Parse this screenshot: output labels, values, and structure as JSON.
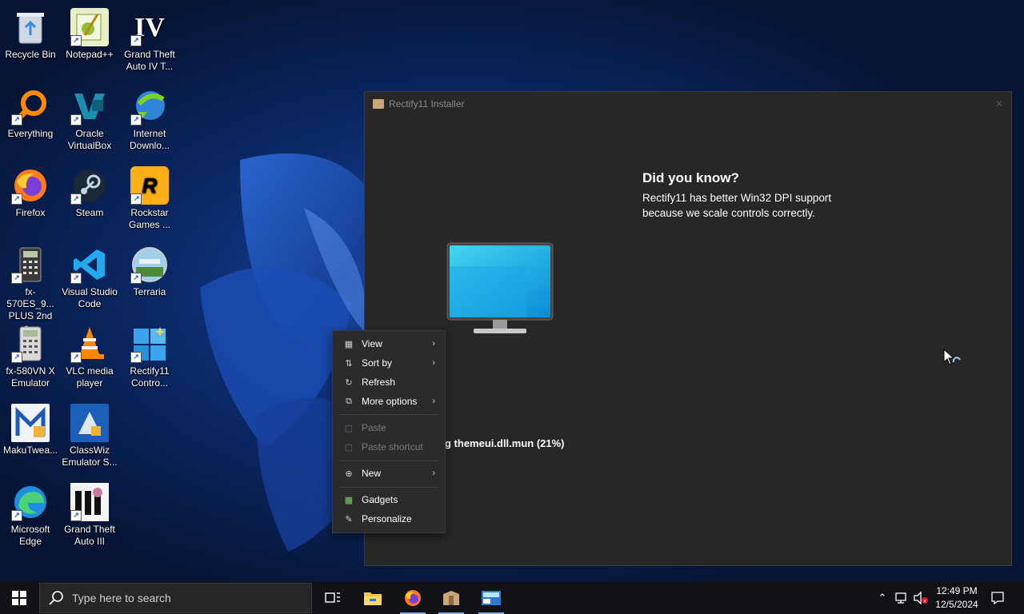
{
  "desktop": {
    "icons": [
      {
        "label": "Recycle Bin",
        "icon": "recycle-bin-icon"
      },
      {
        "label": "Notepad++",
        "icon": "notepadpp-icon"
      },
      {
        "label": "Grand Theft Auto IV T...",
        "icon": "gta-iv-icon",
        "glyph": "IV"
      },
      {
        "label": "Everything",
        "icon": "everything-search-icon"
      },
      {
        "label": "Oracle VirtualBox",
        "icon": "virtualbox-icon"
      },
      {
        "label": "Internet Downlo...",
        "icon": "internet-download-manager-icon"
      },
      {
        "label": "Firefox",
        "icon": "firefox-icon"
      },
      {
        "label": "Steam",
        "icon": "steam-icon"
      },
      {
        "label": "Rockstar Games ...",
        "icon": "rockstar-games-icon",
        "glyph": "R"
      },
      {
        "label": "fx-570ES_9... PLUS 2nd e...",
        "icon": "calculator-icon"
      },
      {
        "label": "Visual Studio Code",
        "icon": "vscode-icon"
      },
      {
        "label": "Terraria",
        "icon": "terraria-icon"
      },
      {
        "label": "fx-580VN X Emulator",
        "icon": "calculator-icon"
      },
      {
        "label": "VLC media player",
        "icon": "vlc-icon"
      },
      {
        "label": "Rectify11 Contro...",
        "icon": "rectify11-icon"
      },
      {
        "label": "MakuTwea...",
        "icon": "makutweaker-icon"
      },
      {
        "label": "ClassWiz Emulator S...",
        "icon": "classwiz-icon"
      },
      {
        "label": "Microsoft Edge",
        "icon": "edge-icon"
      },
      {
        "label": "Grand Theft Auto III",
        "icon": "gta-iii-icon"
      }
    ]
  },
  "installer": {
    "title": "Rectify11 Installer",
    "did_you_know_title": "Did you know?",
    "did_you_know_body": "Rectify11 has better Win32 DPI support because we scale controls correctly.",
    "progress_text": "g themeui.dll.mun (21%)",
    "progress_percent": 21
  },
  "context_menu": {
    "items": [
      {
        "label": "View",
        "icon": "grid-view-icon",
        "submenu": true
      },
      {
        "label": "Sort by",
        "icon": "sort-icon",
        "submenu": true
      },
      {
        "label": "Refresh",
        "icon": "refresh-icon",
        "submenu": false
      },
      {
        "label": "More options",
        "icon": "more-options-icon",
        "submenu": true
      },
      {
        "label": "Paste",
        "icon": "paste-icon",
        "disabled": true
      },
      {
        "label": "Paste shortcut",
        "icon": "paste-shortcut-icon",
        "disabled": true
      },
      {
        "label": "New",
        "icon": "new-icon",
        "submenu": true
      },
      {
        "label": "Gadgets",
        "icon": "gadgets-icon"
      },
      {
        "label": "Personalize",
        "icon": "personalize-icon"
      }
    ]
  },
  "taskbar": {
    "search_placeholder": "Type here to search",
    "pinned": [
      "task-view-icon",
      "file-explorer-icon",
      "firefox-icon",
      "installer-icon",
      "rectify11-control-icon"
    ],
    "clock_time": "12:49 PM",
    "clock_date": "12/5/2024"
  },
  "colors": {
    "menu_bg": "#2b2b2b",
    "window_bg": "#272727",
    "taskbar_bg": "#101215",
    "accent": "#0078d4"
  }
}
